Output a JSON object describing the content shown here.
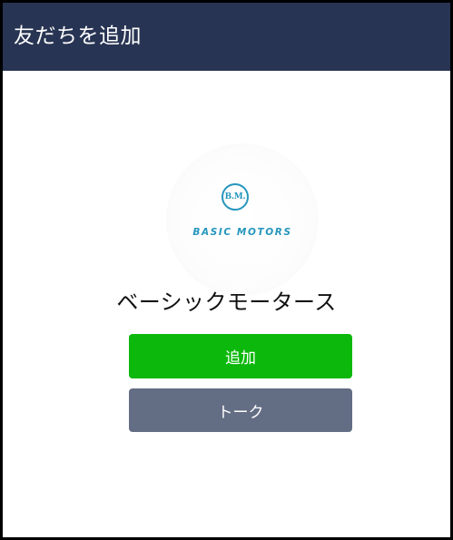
{
  "header": {
    "title": "友だちを追加"
  },
  "profile": {
    "logo_monogram": "B.M.",
    "logo_wordmark": "BASIC MOTORS",
    "name": "ベーシックモータース"
  },
  "actions": {
    "add_label": "追加",
    "talk_label": "トーク"
  },
  "colors": {
    "header_bg": "#283453",
    "add_button": "#0bb80b",
    "talk_button": "#636d84",
    "logo_accent": "#2596bd"
  }
}
